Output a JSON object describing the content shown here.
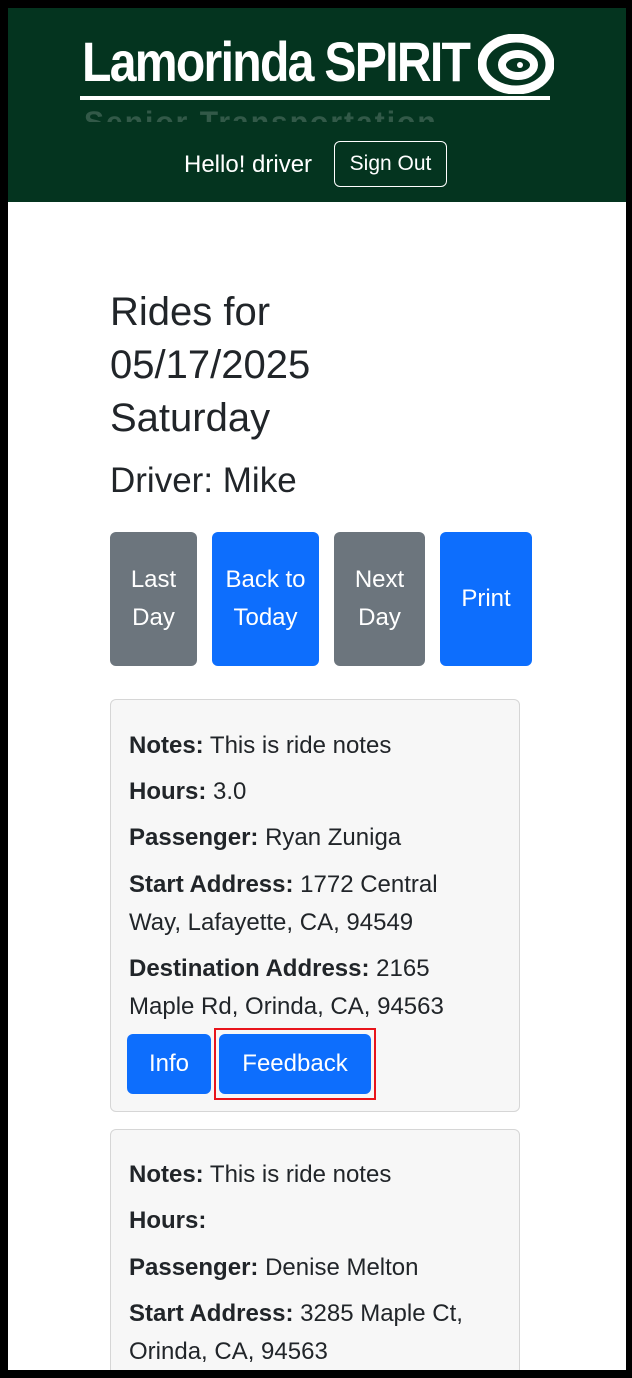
{
  "header": {
    "logo_text": "Lamorinda SPIRIT",
    "logo_tagline": "Senior Transportation",
    "greeting": "Hello! driver",
    "sign_out_label": "Sign Out",
    "bg_color": "#04341f"
  },
  "page": {
    "title_line1": "Rides for",
    "title_line2": "05/17/2025",
    "title_line3": "Saturday",
    "driver_label": "Driver: Mike"
  },
  "nav_buttons": {
    "last_day": "Last Day",
    "back_to_today": "Back to Today",
    "next_day": "Next Day",
    "print": "Print"
  },
  "labels": {
    "notes": "Notes:",
    "hours": "Hours:",
    "passenger": "Passenger:",
    "start_address": "Start Address:",
    "destination_address": "Destination Address:"
  },
  "rides": [
    {
      "notes": "This is ride notes",
      "hours": "3.0",
      "passenger": "Ryan Zuniga",
      "start_address": "1772 Central Way, Lafayette, CA, 94549",
      "destination_address": "2165 Maple Rd, Orinda, CA, 94563",
      "info_label": "Info",
      "feedback_label": "Feedback"
    },
    {
      "notes": "This is ride notes",
      "hours": "",
      "passenger": "Denise Melton",
      "start_address": "3285 Maple Ct, Orinda, CA, 94563"
    }
  ],
  "colors": {
    "primary": "#0d6efd",
    "secondary": "#6c757d",
    "highlight": "#e8141b"
  }
}
